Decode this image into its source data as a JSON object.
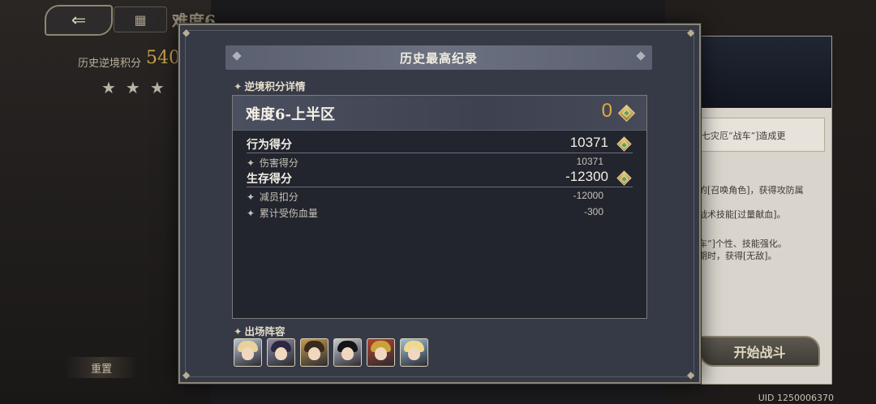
{
  "background": {
    "back_icon": "back-arrow-icon",
    "menu_icon": "grid-menu-icon",
    "difficulty_title": "难度6",
    "history_score_label": "历史逆境积分",
    "history_score_value": "540",
    "stars": "★★★",
    "reset_label": "重置",
    "start_battle_label": "开始战斗",
    "uid_text": "UID 1250006370",
    "right_panel": {
      "line1": "七灾厄“战车”]造成更",
      "line2": "的[召唤角色]，获得攻防属",
      "line3": "战术技能[过量献血]。",
      "line4": "车”]个性、技能强化。",
      "line5": "期时，获得[无敌]。"
    }
  },
  "modal": {
    "title": "历史最高纪录",
    "section_detail_label": "逆境积分详情",
    "difficulty_name": "难度6-上半区",
    "difficulty_score": "0",
    "rows": [
      {
        "label": "行为得分",
        "value": "10371",
        "type": "main"
      },
      {
        "label": "伤害得分",
        "value": "10371",
        "type": "sub"
      },
      {
        "label": "生存得分",
        "value": "-12300",
        "type": "main"
      },
      {
        "label": "减员扣分",
        "value": "-12000",
        "type": "sub"
      },
      {
        "label": "累计受伤血量",
        "value": "-300",
        "type": "sub"
      }
    ],
    "lineup_label": "出场阵容",
    "lineup": [
      {
        "name": "character-1",
        "bg": "#b7c3d4",
        "hair": "#e8d29a"
      },
      {
        "name": "character-2",
        "bg": "#8d8aa4",
        "hair": "#2c2840"
      },
      {
        "name": "character-3",
        "bg": "#c79a4a",
        "hair": "#3a2a1c"
      },
      {
        "name": "character-4",
        "bg": "#c9cbd2",
        "hair": "#141416"
      },
      {
        "name": "character-5",
        "bg": "#b4432e",
        "hair": "#c9a23b"
      },
      {
        "name": "character-6",
        "bg": "#9fc2d9",
        "hair": "#efd98d"
      }
    ]
  },
  "colors": {
    "accent_gold": "#e4a93d",
    "modal_bg": "#363a47"
  }
}
